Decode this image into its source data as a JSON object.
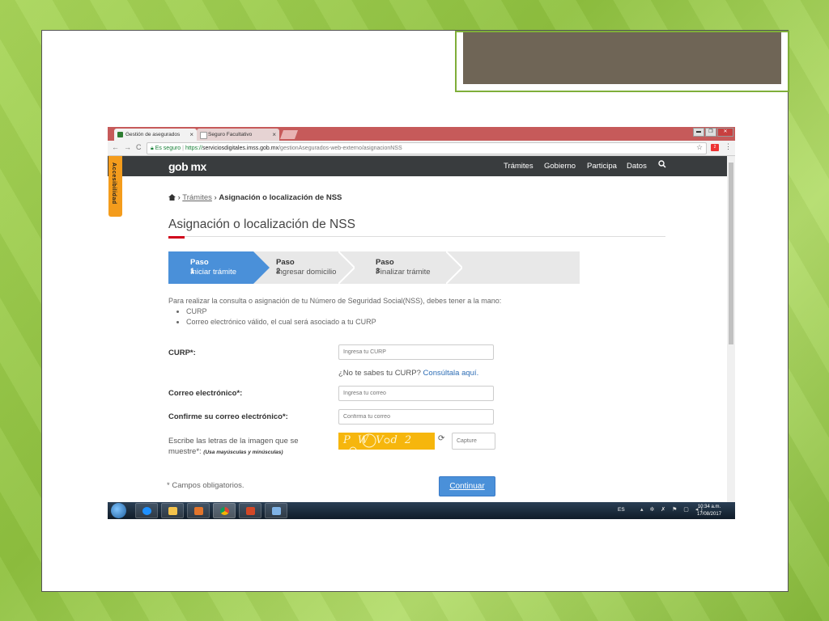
{
  "browser": {
    "tabs": [
      {
        "label": "Gestión de asegurados",
        "close": "×"
      },
      {
        "label": "Seguro Facultativo",
        "close": "×"
      }
    ],
    "window_buttons": [
      "▬",
      "❐",
      "✕"
    ],
    "secure_label": "Es seguro",
    "url_https": "https://",
    "url_host": "serviciosdigitales.imss.gob.mx",
    "url_path": "/gestionAsegurados-web-externo/asignacionNSS",
    "extension_badge": "2"
  },
  "site": {
    "logo": "gob mx",
    "nav": [
      "Trámites",
      "Gobierno",
      "Participa",
      "Datos"
    ],
    "accessibility_tab": "Accesibilidad"
  },
  "breadcrumb": {
    "sep": "›",
    "link": "Trámites",
    "current": "Asignación o localización de NSS"
  },
  "page_title": "Asignación o localización de NSS",
  "steps": [
    {
      "num": "Paso 1",
      "label": "Iniciar trámite",
      "active": true
    },
    {
      "num": "Paso 2",
      "label": "Ingresar domicilio",
      "active": false
    },
    {
      "num": "Paso 3",
      "label": "Finalizar trámite",
      "active": false
    }
  ],
  "intro": {
    "text": "Para realizar la consulta o asignación de tu Número de Seguridad Social(NSS), debes tener a la mano:",
    "items": [
      "CURP",
      "Correo electrónico válido, el cual será asociado a tu CURP"
    ]
  },
  "form": {
    "curp_label": "CURP*:",
    "curp_placeholder": "Ingresa tu CURP",
    "curp_help": "¿No te sabes tu CURP?",
    "curp_help_link": "Consúltala aquí.",
    "email_label": "Correo electrónico*:",
    "email_placeholder": "Ingresa tu correo",
    "confirm_label": "Confirme su correo electrónico*:",
    "confirm_placeholder": "Confirma tu correo",
    "captcha_label": "Escribe las letras de la imagen que se muestre*:",
    "captcha_note": "(Usa mayúsculas y minúsculas)",
    "captcha_text": "PWVd2",
    "captcha_placeholder": "Capture",
    "required_note": "* Campos obligatorios.",
    "continue_label": "Continuar"
  },
  "taskbar": {
    "lang": "ES",
    "time": "10:34 a.m.",
    "date": "17/08/2017"
  },
  "colors": {
    "primary_blue": "#4a90d9",
    "header_dark": "#393c3e",
    "accent_red": "#d0021b",
    "accessibility_orange": "#f49c1c",
    "captcha_yellow": "#f6b60d"
  }
}
